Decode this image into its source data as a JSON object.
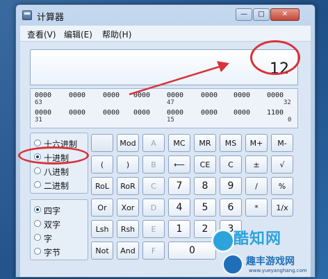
{
  "window": {
    "title": "计算器",
    "caption_min": "—",
    "caption_max": "□",
    "caption_close": "✕",
    "icon": "calculator-icon"
  },
  "menu": {
    "items": [
      "查看(V)",
      "编辑(E)",
      "帮助(H)"
    ]
  },
  "display": {
    "value": "12"
  },
  "bits": {
    "row1": [
      "0000",
      "0000",
      "0000",
      "0000",
      "0000",
      "0000",
      "0000",
      "0000"
    ],
    "row1_marks": [
      "63",
      "47",
      "32"
    ],
    "row2": [
      "0000",
      "0000",
      "0000",
      "0000",
      "0000",
      "0000",
      "0000",
      "1100"
    ],
    "row2_marks": [
      "31",
      "15",
      "0"
    ]
  },
  "radix": {
    "options": [
      "十六进制",
      "十进制",
      "八进制",
      "二进制"
    ],
    "selected": "十进制"
  },
  "word_size": {
    "options": [
      "四字",
      "双字",
      "字",
      "字节"
    ],
    "selected": "四字"
  },
  "keys": {
    "mod": "Mod",
    "A": "A",
    "MC": "MC",
    "MR": "MR",
    "MS": "MS",
    "Mplus": "M+",
    "Mminus": "M-",
    "lparen": "(",
    "rparen": ")",
    "B": "B",
    "backspace": "⟵",
    "CE": "CE",
    "C": "C",
    "plusminus": "±",
    "sqrt": "√",
    "RoL": "RoL",
    "RoR": "RoR",
    "Ckey": "C",
    "n7": "7",
    "n8": "8",
    "n9": "9",
    "div": "/",
    "pct": "%",
    "Or": "Or",
    "Xor": "Xor",
    "D": "D",
    "n4": "4",
    "n5": "5",
    "n6": "6",
    "mul": "*",
    "recip": "1/x",
    "Lsh": "Lsh",
    "Rsh": "Rsh",
    "E": "E",
    "n1": "1",
    "n2": "2",
    "n3": "3",
    "Not": "Not",
    "And": "And",
    "F": "F",
    "n0": "0"
  },
  "watermark": {
    "main": "酷知网",
    "sub": "趣丰游戏网",
    "url": "www.yueyanghang.com"
  },
  "colors": {
    "annotation": "#d8323a",
    "title_bar": "#c4d8ee"
  }
}
